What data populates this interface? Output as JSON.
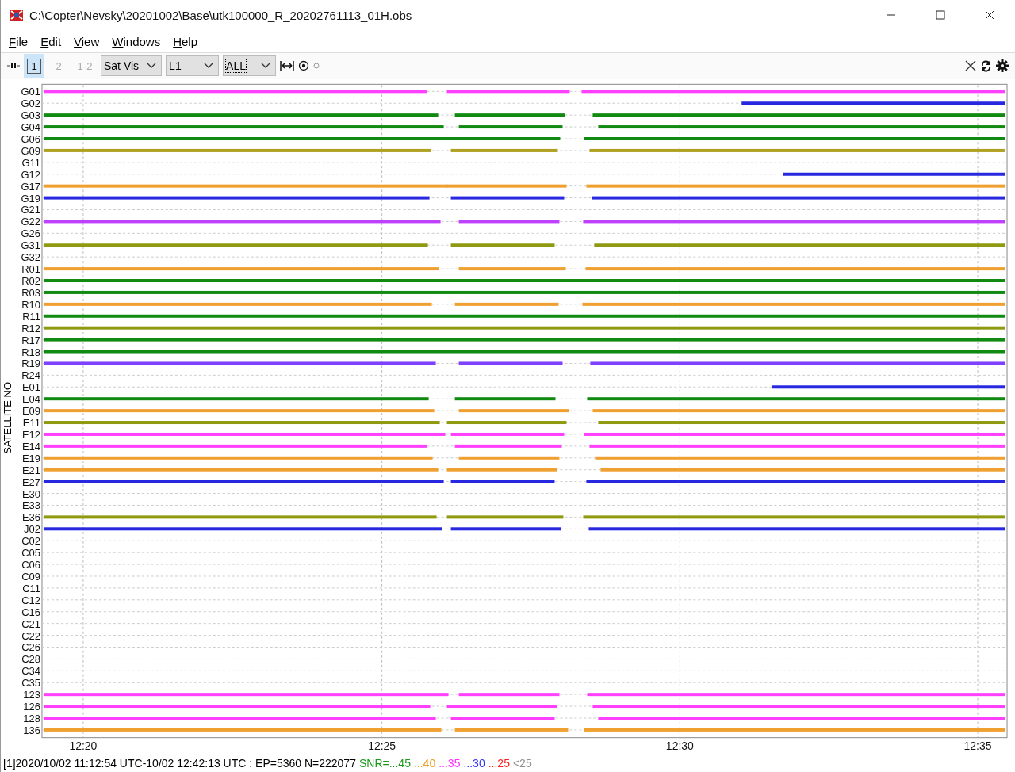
{
  "window": {
    "title": "C:\\Copter\\Nevsky\\20201002\\Base\\utk100000_R_20202761113_01H.obs"
  },
  "menu": [
    "File",
    "Edit",
    "View",
    "Windows",
    "Help"
  ],
  "toolbar": {
    "frequency_buttons": [
      {
        "label": "1",
        "selected": true
      },
      {
        "label": "2",
        "selected": false
      },
      {
        "label": "1-2",
        "selected": false
      }
    ],
    "selects": [
      {
        "value": "Sat Vis",
        "kind": "plain"
      },
      {
        "value": "L1",
        "kind": "plain"
      },
      {
        "value": "ALL",
        "kind": "focused"
      }
    ]
  },
  "plot": {
    "axis_label": "SATELLITE NO",
    "time_labels": [
      "12:20",
      "12:25",
      "12:30",
      "12:35"
    ],
    "satellites": [
      {
        "label": "G01",
        "kind": "gapped",
        "color": "#ff40ff"
      },
      {
        "label": "G02",
        "kind": "late",
        "color": "#2828e0"
      },
      {
        "label": "G03",
        "kind": "gapped",
        "color": "#118a11"
      },
      {
        "label": "G04",
        "kind": "gapped",
        "color": "#118a11"
      },
      {
        "label": "G06",
        "kind": "gapped",
        "color": "#118a11"
      },
      {
        "label": "G09",
        "kind": "gapped",
        "color": "#b0a020"
      },
      {
        "label": "G11",
        "kind": "none"
      },
      {
        "label": "G12",
        "kind": "late",
        "color": "#2828e0"
      },
      {
        "label": "G17",
        "kind": "gapped",
        "color": "#f0a030"
      },
      {
        "label": "G19",
        "kind": "gapped",
        "color": "#2828e0"
      },
      {
        "label": "G21",
        "kind": "none"
      },
      {
        "label": "G22",
        "kind": "gapped",
        "color": "#c040ff"
      },
      {
        "label": "G26",
        "kind": "none"
      },
      {
        "label": "G31",
        "kind": "gapped",
        "color": "#909a10"
      },
      {
        "label": "G32",
        "kind": "none"
      },
      {
        "label": "R01",
        "kind": "gapped",
        "color": "#f0a030"
      },
      {
        "label": "R02",
        "kind": "continuous",
        "color": "#118a11"
      },
      {
        "label": "R03",
        "kind": "continuous",
        "color": "#118a11"
      },
      {
        "label": "R10",
        "kind": "gapped",
        "color": "#f0a030"
      },
      {
        "label": "R11",
        "kind": "continuous",
        "color": "#118a11"
      },
      {
        "label": "R12",
        "kind": "continuous",
        "color": "#909a10"
      },
      {
        "label": "R17",
        "kind": "continuous",
        "color": "#118a11"
      },
      {
        "label": "R18",
        "kind": "continuous",
        "color": "#118a11"
      },
      {
        "label": "R19",
        "kind": "gapped",
        "color": "#8040ff"
      },
      {
        "label": "R24",
        "kind": "none"
      },
      {
        "label": "E01",
        "kind": "late",
        "color": "#2828e0"
      },
      {
        "label": "E04",
        "kind": "gapped",
        "color": "#118a11"
      },
      {
        "label": "E09",
        "kind": "gapped",
        "color": "#f0a030"
      },
      {
        "label": "E11",
        "kind": "gapped",
        "color": "#909a10"
      },
      {
        "label": "E12",
        "kind": "gapped",
        "color": "#ff40ff"
      },
      {
        "label": "E14",
        "kind": "gapped",
        "color": "#ff40ff"
      },
      {
        "label": "E19",
        "kind": "gapped",
        "color": "#f0a030"
      },
      {
        "label": "E21",
        "kind": "gapped",
        "color": "#f0a030"
      },
      {
        "label": "E27",
        "kind": "gapped",
        "color": "#2828e0"
      },
      {
        "label": "E30",
        "kind": "none"
      },
      {
        "label": "E33",
        "kind": "none"
      },
      {
        "label": "E36",
        "kind": "gapped",
        "color": "#909a10"
      },
      {
        "label": "J02",
        "kind": "gapped",
        "color": "#2828e0"
      },
      {
        "label": "C02",
        "kind": "none"
      },
      {
        "label": "C05",
        "kind": "none"
      },
      {
        "label": "C06",
        "kind": "none"
      },
      {
        "label": "C09",
        "kind": "none"
      },
      {
        "label": "C11",
        "kind": "none"
      },
      {
        "label": "C12",
        "kind": "none"
      },
      {
        "label": "C16",
        "kind": "none"
      },
      {
        "label": "C21",
        "kind": "none"
      },
      {
        "label": "C22",
        "kind": "none"
      },
      {
        "label": "C26",
        "kind": "none"
      },
      {
        "label": "C28",
        "kind": "none"
      },
      {
        "label": "C34",
        "kind": "none"
      },
      {
        "label": "C35",
        "kind": "none"
      },
      {
        "label": "123",
        "kind": "gapped",
        "color": "#ff40ff"
      },
      {
        "label": "126",
        "kind": "gapped",
        "color": "#ff40ff"
      },
      {
        "label": "128",
        "kind": "gapped",
        "color": "#ff40ff"
      },
      {
        "label": "136",
        "kind": "gapped",
        "color": "#f0a030"
      }
    ]
  },
  "status_bar": {
    "text": "[1]2020/10/02 11:12:54 UTC-10/02 12:42:13 UTC : EP=5360 N=222077",
    "snr_legend": [
      {
        "label": "SNR=...45",
        "color": "#1a9a1a"
      },
      {
        "label": "...40",
        "color": "#f0a020"
      },
      {
        "label": "...35",
        "color": "#ff30ff"
      },
      {
        "label": "...30",
        "color": "#3030ff"
      },
      {
        "label": "...25",
        "color": "#ff2020"
      },
      {
        "label": "<25",
        "color": "#909090"
      }
    ]
  }
}
